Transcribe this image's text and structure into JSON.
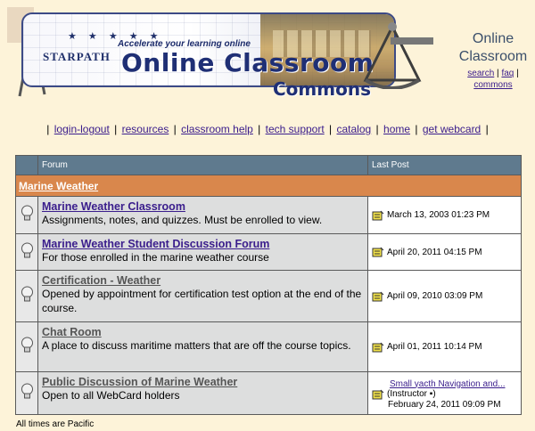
{
  "banner": {
    "tagline": "Accelerate your learning online",
    "brand": "STARPATH",
    "title_line1": "Online Classroom",
    "title_line2": "Commons"
  },
  "site_box": {
    "name": "Online Classroom",
    "links": {
      "search": "search",
      "faq": "faq",
      "commons": "commons"
    }
  },
  "nav": [
    "login-logout",
    "resources",
    "classroom help",
    "tech support",
    "catalog",
    "home",
    "get webcard"
  ],
  "table": {
    "headers": {
      "forum": "Forum",
      "last_post": "Last Post"
    },
    "category": "Marine Weather",
    "forums": [
      {
        "title": "Marine Weather Classroom",
        "description": "Assignments, notes, and quizzes. Must be enrolled to view.",
        "last_post": "March 13, 2003 01:23 PM",
        "visited": false
      },
      {
        "title": "Marine Weather Student Discussion Forum",
        "description": "For those enrolled in the marine weather course",
        "last_post": "April 20, 2011 04:15 PM",
        "visited": false
      },
      {
        "title": "Certification - Weather",
        "description": "Opened by appointment for certification test option at the end of the course.",
        "last_post": "April 09, 2010 03:09 PM",
        "visited": true
      },
      {
        "title": "Chat Room",
        "description": "A place to discuss maritime matters that are off the course topics.",
        "last_post": "April 01, 2011 10:14 PM",
        "visited": true
      },
      {
        "title": "Public Discussion of Marine Weather",
        "description": "Open to all WebCard holders",
        "last_post_topic": "Small yacth Navigation and...",
        "last_post_author": "(Instructor ▪)",
        "last_post": "February 24, 2011 09:09 PM",
        "visited": true
      }
    ]
  },
  "footer_note": "All times are Pacific"
}
